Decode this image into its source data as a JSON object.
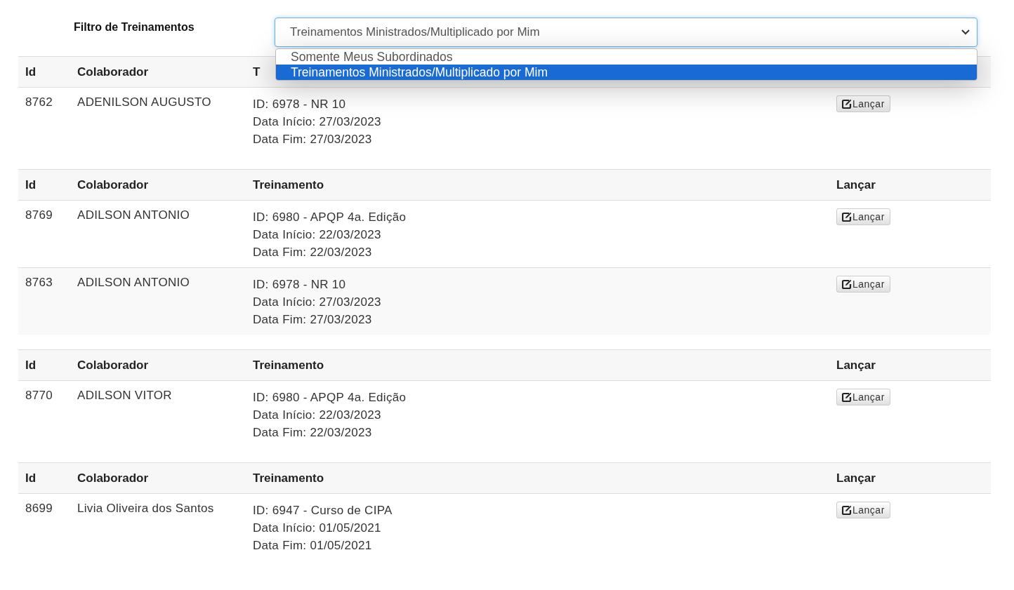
{
  "filter": {
    "label": "Filtro de Treinamentos",
    "value": "Treinamentos Ministrados/Multiplicado por Mim",
    "expanded": true,
    "options": [
      {
        "label": "Somente Meus Subordinados",
        "selected": false
      },
      {
        "label": "Treinamentos Ministrados/Multiplicado por Mim",
        "selected": true
      }
    ]
  },
  "tables": [
    {
      "columns": [
        "Id",
        "Colaborador",
        "T"
      ],
      "rows": [
        {
          "id": "8762",
          "colaborador": "ADENILSON AUGUSTO",
          "treinamento": [
            "ID: 6978 - NR 10",
            "Data Início: 27/03/2023",
            "Data Fim: 27/03/2023"
          ],
          "button": "Lançar"
        }
      ]
    },
    {
      "columns": [
        "Id",
        "Colaborador",
        "Treinamento",
        "Lançar"
      ],
      "rows": [
        {
          "id": "8769",
          "colaborador": "ADILSON ANTONIO",
          "treinamento": [
            "ID: 6980 - APQP 4a. Edição",
            "Data Início: 22/03/2023",
            "Data Fim: 22/03/2023"
          ],
          "button": "Lançar"
        },
        {
          "id": "8763",
          "colaborador": "ADILSON ANTONIO",
          "treinamento": [
            "ID: 6978 - NR 10",
            "Data Início: 27/03/2023",
            "Data Fim: 27/03/2023"
          ],
          "button": "Lançar"
        }
      ]
    },
    {
      "columns": [
        "Id",
        "Colaborador",
        "Treinamento",
        "Lançar"
      ],
      "rows": [
        {
          "id": "8770",
          "colaborador": "ADILSON VITOR",
          "treinamento": [
            "ID: 6980 - APQP 4a. Edição",
            "Data Início: 22/03/2023",
            "Data Fim: 22/03/2023"
          ],
          "button": "Lançar"
        }
      ]
    },
    {
      "columns": [
        "Id",
        "Colaborador",
        "Treinamento",
        "Lançar"
      ],
      "rows": [
        {
          "id": "8699",
          "colaborador": "Livia Oliveira dos Santos",
          "treinamento": [
            "ID: 6947 - Curso de CIPA",
            "Data Início: 01/05/2021",
            "Data Fim: 01/05/2021"
          ],
          "button": "Lançar"
        }
      ]
    }
  ]
}
